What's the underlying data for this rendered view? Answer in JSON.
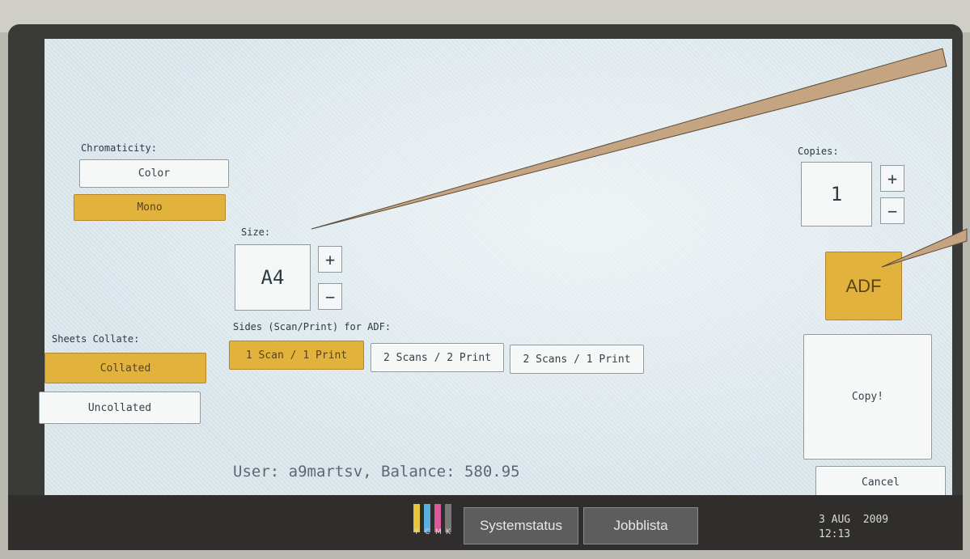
{
  "chromaticity": {
    "label": "Chromaticity:",
    "options": [
      "Color",
      "Mono"
    ],
    "selected": "Mono"
  },
  "size": {
    "label": "Size:",
    "value": "A4",
    "plus": "+",
    "minus": "−"
  },
  "sides": {
    "label": "Sides (Scan/Print) for ADF:",
    "options": [
      "1 Scan / 1 Print",
      "2 Scans / 2 Print",
      "2 Scans / 1 Print"
    ],
    "selected": "1 Scan / 1 Print"
  },
  "collate": {
    "label": "Sheets Collate:",
    "options": [
      "Collated",
      "Uncollated"
    ],
    "selected": "Collated"
  },
  "copies": {
    "label": "Copies:",
    "value": "1",
    "plus": "+",
    "minus": "−"
  },
  "source": {
    "label": "ADF"
  },
  "actions": {
    "copy": "Copy!",
    "cancel": "Cancel"
  },
  "status": {
    "user_line": "User: a9martsv, Balance: 580.95"
  },
  "taskbar": {
    "systemstatus": "Systemstatus",
    "jobblista": "Jobblista",
    "ink_letters": [
      "Y",
      "C",
      "M",
      "K"
    ],
    "date": "3 AUG  2009",
    "time": "12:13"
  },
  "colors": {
    "selected": "#e2b33c",
    "screen": "#dfe9ee",
    "ink_y": "#e6c53c",
    "ink_c": "#5aaee0",
    "ink_m": "#d85a9a",
    "ink_k": "#777777"
  }
}
